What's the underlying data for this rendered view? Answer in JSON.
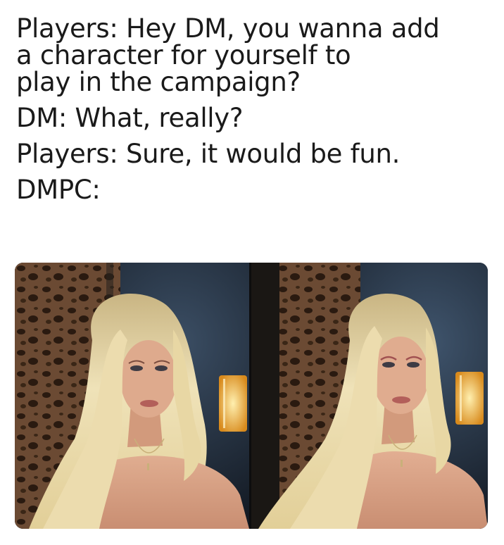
{
  "caption": {
    "lines": [
      "Players: Hey DM, you wanna add",
      "a character for yourself to",
      "play in the campaign?",
      "DM: What, really?",
      "Players: Sure, it would be fun.",
      "DMPC:"
    ]
  },
  "photos": [
    {
      "icon": "person-photo",
      "side": "left"
    },
    {
      "icon": "person-photo",
      "side": "right"
    }
  ],
  "colors": {
    "background": "#ffffff",
    "text": "#1a1a1a",
    "hair": "#e6d6a8",
    "skin": "#d9a58a",
    "lamp": "#f2b030",
    "leopard_bg": "#5a4030",
    "wall": "#1e2a38"
  }
}
